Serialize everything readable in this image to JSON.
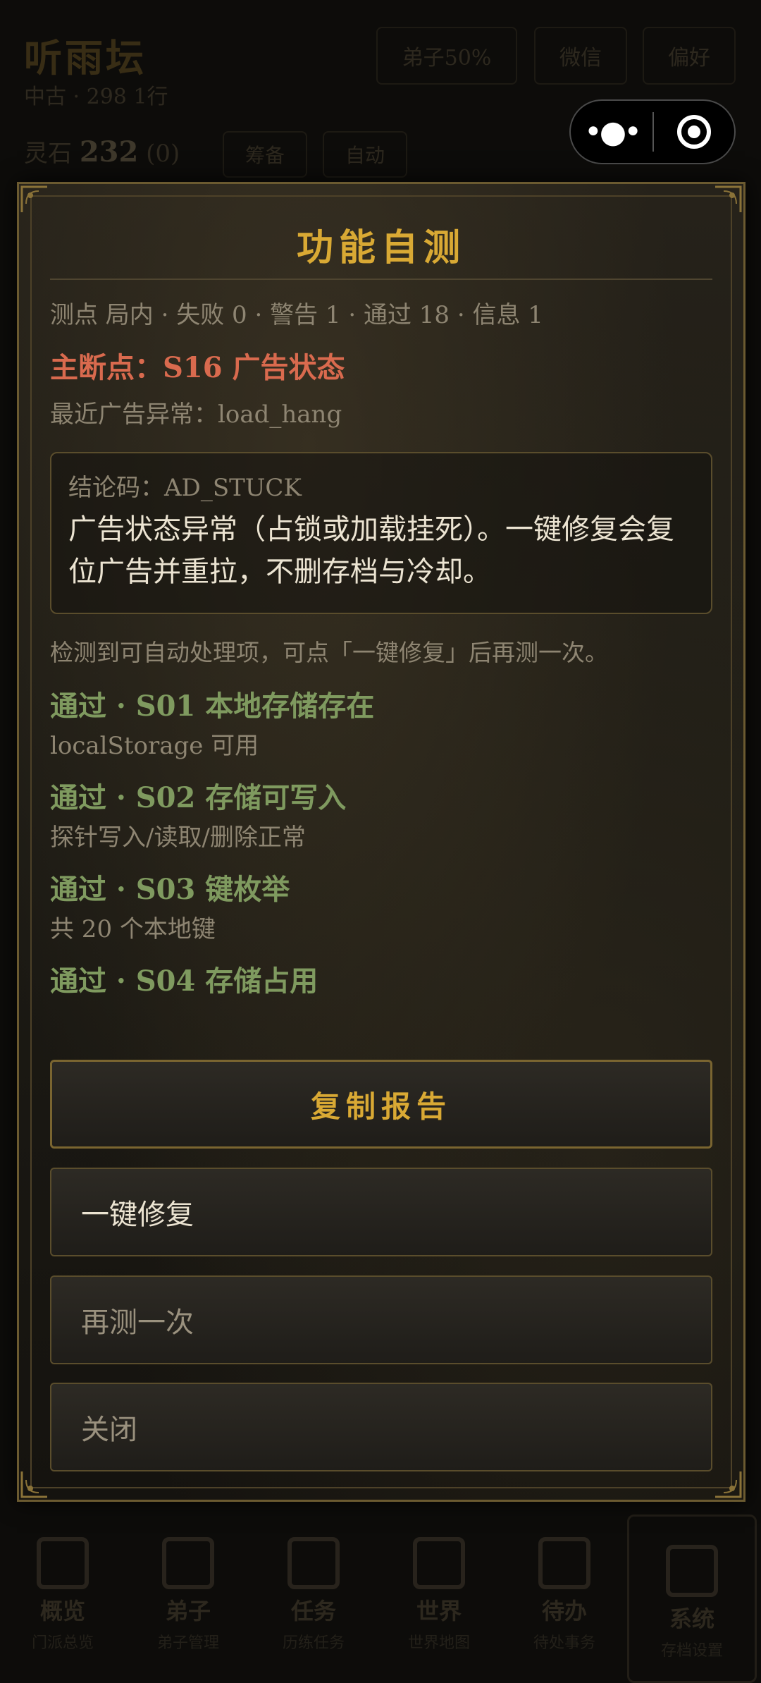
{
  "background": {
    "title": "听雨坛",
    "subtitle": "中古 · 298 1行",
    "pills": [
      "弟子50%",
      "微信",
      "偏好"
    ],
    "stat_label": "灵石",
    "stat_value": "232",
    "stat_extra": "(0)",
    "chips": [
      "筹备",
      "自动"
    ],
    "nav": [
      {
        "label": "概览",
        "sub": "门派总览"
      },
      {
        "label": "弟子",
        "sub": "弟子管理"
      },
      {
        "label": "任务",
        "sub": "历练任务"
      },
      {
        "label": "世界",
        "sub": "世界地图"
      },
      {
        "label": "待办",
        "sub": "待处事务"
      },
      {
        "label": "系统",
        "sub": "存档设置"
      }
    ]
  },
  "capsule": {
    "more_icon": "more-dots-icon",
    "close_icon": "target-circle-icon"
  },
  "modal": {
    "title": "功能自测",
    "summary": "测点 局内 · 失败 0 · 警告 1 · 通过 18 · 信息 1",
    "main_point": "主断点：S16 广告状态",
    "recent": "最近广告异常：load_hang",
    "conclusion_code": "结论码：AD_STUCK",
    "conclusion_text": "广告状态异常（占锁或加载挂死）。一键修复会复位广告并重拉，不删存档与冷却。",
    "hint": "检测到可自动处理项，可点「一键修复」后再测一次。",
    "checks": [
      {
        "title": "通过 · S01 本地存储存在",
        "desc": "localStorage 可用"
      },
      {
        "title": "通过 · S02 存储可写入",
        "desc": "探针写入/读取/删除正常"
      },
      {
        "title": "通过 · S03 键枚举",
        "desc": "共 20 个本地键"
      },
      {
        "title": "通过 · S04 存储占用",
        "desc": ""
      }
    ],
    "buttons": {
      "copy": "复制报告",
      "fix": "一键修复",
      "retest": "再测一次",
      "close": "关闭"
    }
  },
  "colors": {
    "accent_gold": "#d9a934",
    "error_red": "#d96a4e",
    "pass_green": "#7f9a5f"
  }
}
